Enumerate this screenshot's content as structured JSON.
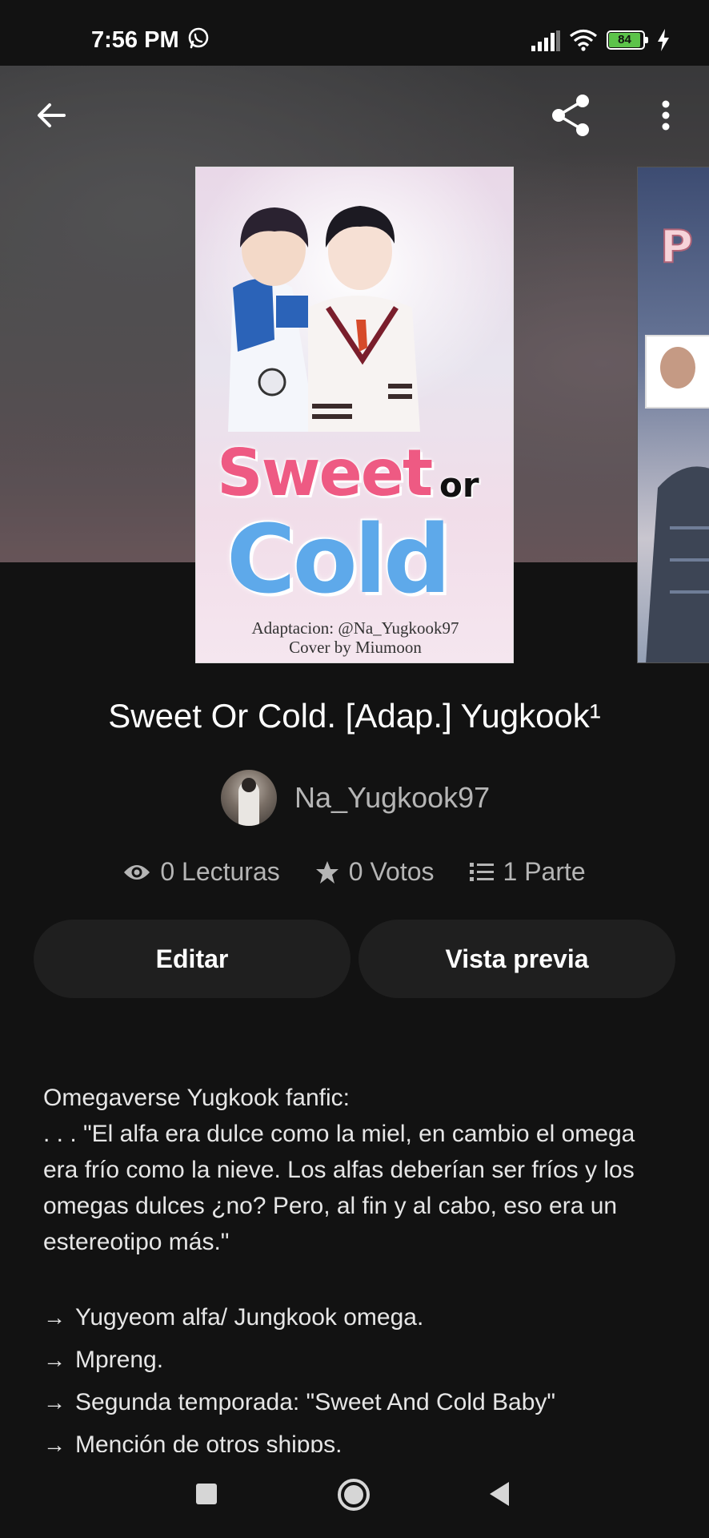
{
  "status_bar": {
    "time": "7:56 PM",
    "battery": "84",
    "icons": [
      "whatsapp-icon",
      "signal-icon",
      "wifi-icon",
      "battery-icon",
      "charging-icon"
    ]
  },
  "toolbar": {
    "icons": [
      "back-arrow-icon",
      "share-icon",
      "more-vert-icon"
    ]
  },
  "cover": {
    "title_word_1": "Sweet",
    "title_word_2": "or",
    "title_word_3": "Cold",
    "credit_1": "Adaptacion: @Na_Yugkook97",
    "credit_2": "Cover by Miumoon"
  },
  "story": {
    "title": "Sweet Or Cold. [Adap.] Yugkook¹",
    "author": "Na_Yugkook97",
    "stats": {
      "reads": "0 Lecturas",
      "votes": "0 Votos",
      "parts": "1 Parte"
    }
  },
  "actions": {
    "edit": "Editar",
    "preview": "Vista previa"
  },
  "description": {
    "line_1": "Omegaverse Yugkook fanfic:",
    "paragraph": ". . . \"El alfa era dulce como la miel, en cambio el omega era frío como la nieve. Los alfas deberían ser fríos y los omegas dulces ¿no? Pero, al fin y al cabo, eso era un estereotipo más.\"",
    "bullet_symbol": "→",
    "bullets": [
      "Yugyeom alfa/ Jungkook omega.",
      "Mpreng.",
      "Segunda temporada: \"Sweet And Cold Baby\"",
      "Mención de otros shipps."
    ]
  },
  "nav_bar": {
    "icons": [
      "recents-icon",
      "home-icon",
      "back-icon"
    ]
  }
}
